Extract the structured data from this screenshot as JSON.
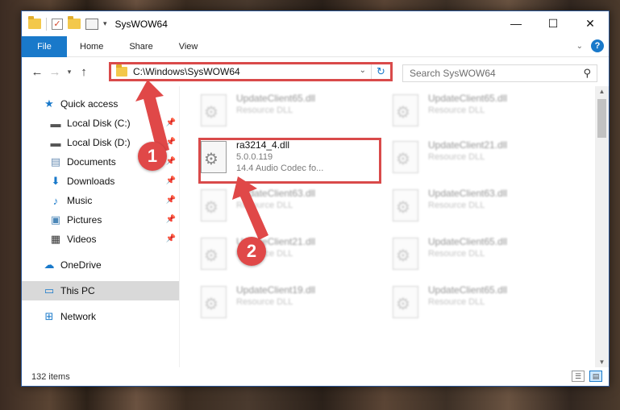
{
  "window": {
    "title": "SysWOW64",
    "controls": [
      "—",
      "☐",
      "✕"
    ]
  },
  "ribbon": {
    "file": "File",
    "tabs": [
      "Home",
      "Share",
      "View"
    ],
    "help": "?"
  },
  "nav": {
    "address": "C:\\Windows\\SysWOW64",
    "search_placeholder": "Search SysWOW64"
  },
  "sidebar": {
    "items": [
      {
        "label": "Quick access"
      },
      {
        "label": "Local Disk (C:)"
      },
      {
        "label": "Local Disk (D:)"
      },
      {
        "label": "Documents"
      },
      {
        "label": "Downloads"
      },
      {
        "label": "Music"
      },
      {
        "label": "Pictures"
      },
      {
        "label": "Videos"
      },
      {
        "label": "OneDrive"
      },
      {
        "label": "This PC"
      },
      {
        "label": "Network"
      }
    ]
  },
  "files": [
    {
      "name": "UpdateClient65.dll",
      "type": "Resource DLL"
    },
    {
      "name": "UpdateClient65.dll",
      "type": "Resource DLL"
    },
    {
      "name": "ra3214_4.dll",
      "version": "5.0.0.119",
      "desc": "14.4 Audio Codec fo..."
    },
    {
      "name": "UpdateClient21.dll",
      "type": "Resource DLL"
    },
    {
      "name": "UpdateClient63.dll",
      "type": "Resource DLL"
    },
    {
      "name": "UpdateClient63.dll",
      "type": "Resource DLL"
    },
    {
      "name": "UpdateClient21.dll",
      "type": "Resource DLL"
    },
    {
      "name": "UpdateClient65.dll",
      "type": "Resource DLL"
    },
    {
      "name": "UpdateClient19.dll",
      "type": "Resource DLL"
    },
    {
      "name": "UpdateClient65.dll",
      "type": "Resource DLL"
    }
  ],
  "status": {
    "items": "132 items"
  },
  "annotations": {
    "badge1": "1",
    "badge2": "2",
    "color": "#e04848"
  }
}
